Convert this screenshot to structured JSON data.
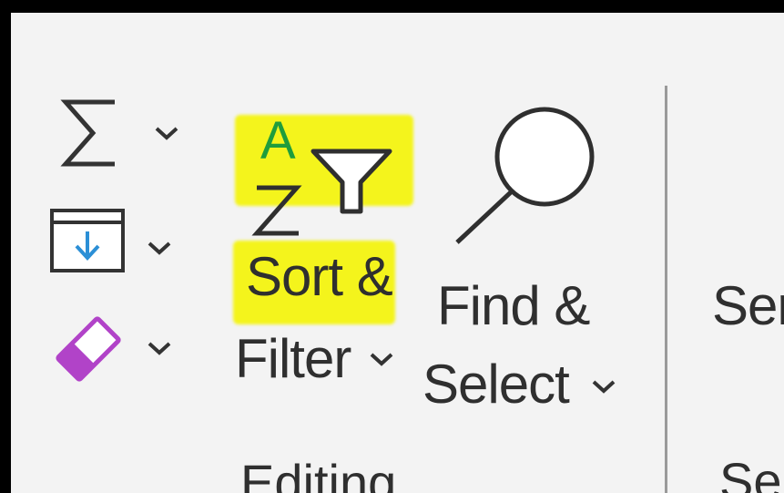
{
  "ribbon": {
    "group": {
      "label": "Editing"
    },
    "autosum": {
      "icon": "sigma-icon"
    },
    "fill": {
      "icon": "fill-down-icon"
    },
    "clear": {
      "icon": "eraser-icon"
    },
    "sort_filter": {
      "line1": "Sort &",
      "line2": "Filter",
      "icon": "sort-az-filter-icon",
      "highlight_color": "#f4f41c",
      "highlighted": true
    },
    "find_select": {
      "line1": "Find &",
      "line2": "Select",
      "icon": "magnifier-icon"
    },
    "next_group": {
      "button_partial": "Ser",
      "label_partial": "Ser"
    },
    "colors": {
      "accent_blue": "#2b8fd6",
      "eraser_purple": "#b143c8",
      "az_green": "#1f9d3c"
    }
  }
}
